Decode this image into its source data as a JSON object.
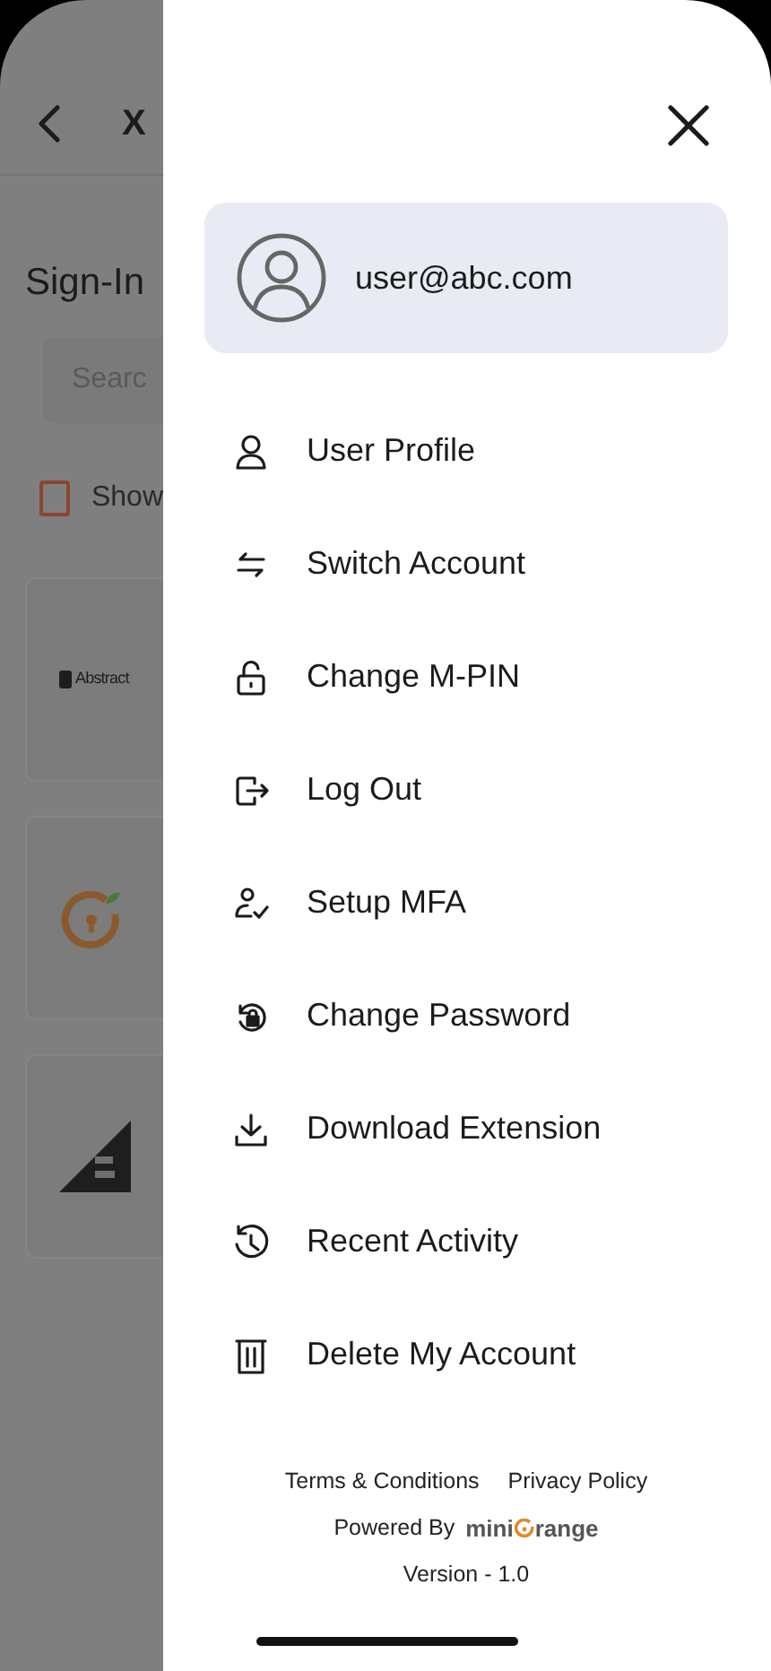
{
  "background": {
    "title": "X",
    "heading": "Sign-In",
    "search": {
      "placeholder": "Searc"
    },
    "show_checkbox": {
      "label": "Show",
      "checked": false
    },
    "apps": [
      {
        "kind": "wordmark",
        "label": "Abstract"
      },
      {
        "kind": "emblem"
      },
      {
        "kind": "emblem"
      }
    ]
  },
  "drawer": {
    "account": {
      "email": "user@abc.com"
    },
    "menu": [
      {
        "label": "User Profile"
      },
      {
        "label": "Switch Account"
      },
      {
        "label": "Change M-PIN"
      },
      {
        "label": "Log Out"
      },
      {
        "label": "Setup MFA"
      },
      {
        "label": "Change Password"
      },
      {
        "label": "Download Extension"
      },
      {
        "label": "Recent Activity"
      },
      {
        "label": "Delete My Account"
      }
    ],
    "footer": {
      "links": [
        "Terms & Conditions",
        "Privacy Policy"
      ],
      "powered_by": "Powered By",
      "brand_prefix": "mini",
      "brand_suffix": "range",
      "version": "Version - 1.0"
    }
  }
}
